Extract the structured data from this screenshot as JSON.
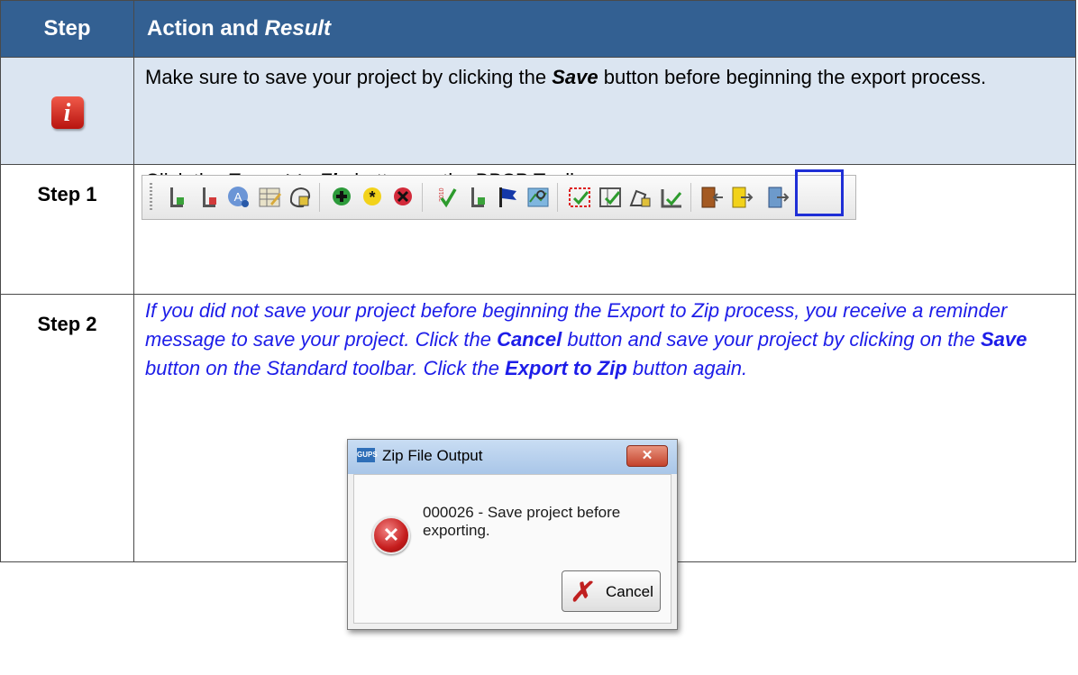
{
  "table": {
    "header_step": "Step",
    "header_action": "Action and ",
    "header_result": "Result",
    "info_row": {
      "text_a": "Make sure to save your project by clicking the ",
      "text_bold": "Save",
      "text_b": " button before beginning the export process."
    },
    "step1": {
      "label": "Step 1",
      "text_a": "Click the ",
      "text_bold": "Export to Zip",
      "text_b": " button on the BBSP Toolbar."
    },
    "step2": {
      "label": "Step 2",
      "t1": "If you did not save your project before beginning the Export to Zip process, you receive a reminder message to save your project. Click the ",
      "b1": "Cancel",
      "t2": " button and save your project by clicking on the ",
      "b2": "Save",
      "t3": " button on the Standard toolbar.  Click the ",
      "b3": "Export to Zip",
      "t4": " button again."
    }
  },
  "dialog": {
    "app_icon_text": "GUPS",
    "title": "Zip File Output",
    "close_glyph": "✕",
    "message": "000026 - Save project before exporting.",
    "cancel_label": "Cancel"
  },
  "icons": {
    "info": "info-icon",
    "error": "error-icon"
  },
  "colors": {
    "header_bg": "#336092",
    "info_row_bg": "#dbe5f1",
    "step2_text": "#1d1de8",
    "highlight_border": "#1f2fd6"
  }
}
